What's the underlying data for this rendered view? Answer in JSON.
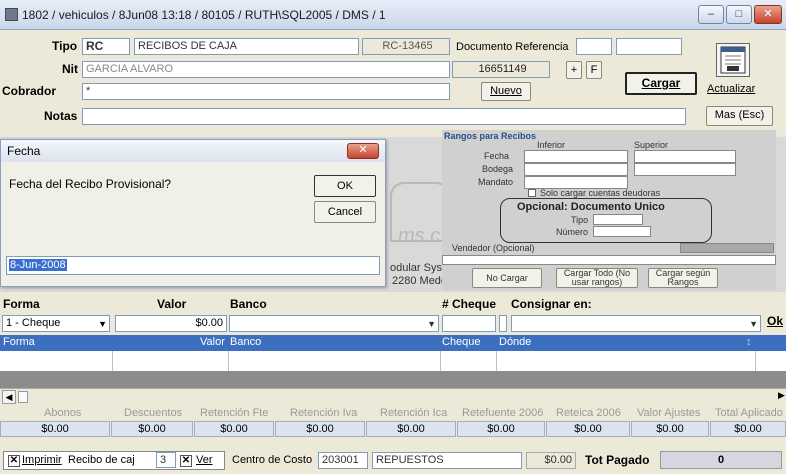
{
  "window": {
    "title": "1802 / vehiculos / 8Jun08 13:18 / 80105 / RUTH\\SQL2005 / DMS / 1"
  },
  "form": {
    "tipo_label": "Tipo",
    "tipo_code": "RC",
    "tipo_name": "RECIBOS DE CAJA",
    "tipo_number": "RC-13465",
    "doc_ref_label": "Documento Referencia",
    "nit_label": "Nit",
    "nit_value": "GARCIA ALVARO",
    "nit_number": "16651149",
    "plus_label": "+",
    "f_label": "F",
    "cobrador_label": "Cobrador",
    "cobrador_value": "*",
    "nuevo_label": "Nuevo",
    "cargar_label": "Cargar",
    "actualizar_label": "Actualizar",
    "notas_label": "Notas",
    "mas_label": "Mas (Esc)"
  },
  "dialog": {
    "title": "Fecha",
    "question": "Fecha del Recibo Provisional?",
    "ok_label": "OK",
    "cancel_label": "Cancel",
    "date_value": "8-Jun-2008"
  },
  "background_text": {
    "line1": "odular Syst",
    "line2": "2280 Medel",
    "line3": "ms.c"
  },
  "rangos": {
    "title": "Rangos para Recibos",
    "inferior": "Inferior",
    "superior": "Superior",
    "fecha": "Fecha",
    "bodega": "Bodega",
    "mandato": "Mandato",
    "solo_cargar": "Solo cargar cuentas deudoras",
    "opcional_title": "Opcional: Documento Unico",
    "tipo": "Tipo",
    "numero": "Número",
    "vendedor": "Vendedor (Opcional)",
    "no_cargar": "No Cargar",
    "cargar_todo": "Cargar Todo (No usar rangos)",
    "cargar_segun": "Cargar según Rangos"
  },
  "payment": {
    "forma_label": "Forma",
    "valor_label": "Valor",
    "banco_label": "Banco",
    "cheque_label": "# Cheque",
    "consignar_label": "Consignar en:",
    "forma_value": "1 - Cheque",
    "valor_value": "$0.00",
    "ok_label": "Ok"
  },
  "table": {
    "headers": [
      "Forma",
      "Valor",
      "Banco",
      "Cheque",
      "Dónde"
    ]
  },
  "totals": {
    "labels": [
      "Abonos",
      "Descuentos",
      "Retención Fte",
      "Retención Iva",
      "Retención Ica",
      "Retefuente 2006",
      "Reteica 2006",
      "Valor Ajustes",
      "Total Aplicado"
    ],
    "values": [
      "$0.00",
      "$0.00",
      "$0.00",
      "$0.00",
      "$0.00",
      "$0.00",
      "$0.00",
      "$0.00",
      "$0.00"
    ]
  },
  "bottom": {
    "imprimir_label": "Imprimir",
    "recibo_label": "Recibo de caj",
    "recibo_num": "3",
    "ver_label": "Ver",
    "centro_label": "Centro de Costo",
    "centro_code": "203001",
    "centro_name": "REPUESTOS",
    "amount": "$0.00",
    "tot_pagado_label": "Tot Pagado",
    "tot_pagado_value": "0"
  },
  "colors": {
    "table_header": "#3d6fc0",
    "date_selected": "#3a6fd0"
  }
}
